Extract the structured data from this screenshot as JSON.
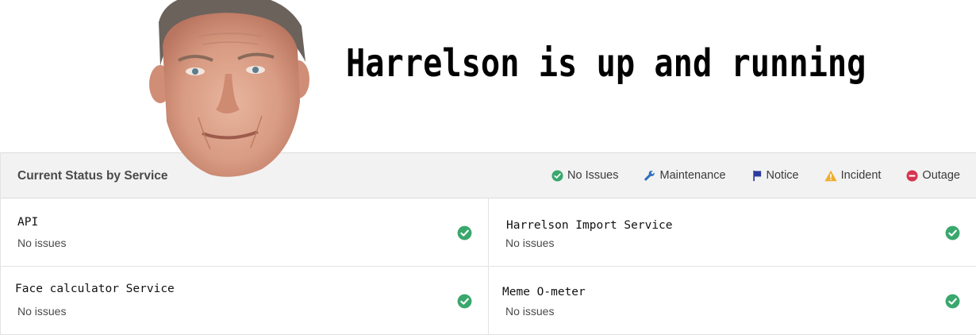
{
  "headline": "Harrelson is up and running",
  "panel": {
    "title": "Current Status by Service",
    "legend": [
      {
        "label": "No Issues",
        "icon": "check-circle-icon",
        "color": "#3aa76d"
      },
      {
        "label": "Maintenance",
        "icon": "wrench-icon",
        "color": "#2f6fbd"
      },
      {
        "label": "Notice",
        "icon": "flag-icon",
        "color": "#2b3a9e"
      },
      {
        "label": "Incident",
        "icon": "warning-triangle-icon",
        "color": "#f0ad2e"
      },
      {
        "label": "Outage",
        "icon": "minus-circle-icon",
        "color": "#d7344f"
      }
    ]
  },
  "services": [
    {
      "name": "API",
      "status": "No issues"
    },
    {
      "name": "Harrelson Import Service",
      "status": "No issues"
    },
    {
      "name": "Face calculator Service",
      "status": "No issues"
    },
    {
      "name": "Meme O-meter",
      "status": "No issues"
    }
  ]
}
